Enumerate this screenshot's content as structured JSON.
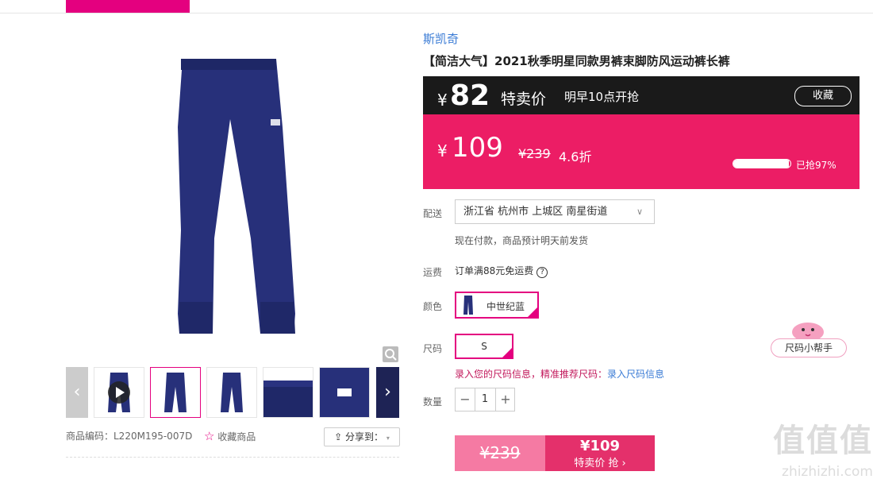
{
  "nav": {
    "active_color": "#e4007f"
  },
  "product": {
    "brand": "斯凯奇",
    "title": "【简洁大气】2021秋季明星同款男裤束脚防风运动裤长裤",
    "code_label": "商品编码：L220M195-007D",
    "favorite_label": "收藏商品",
    "share_label": "分享到：",
    "image_alt": "navy jogger pants"
  },
  "price": {
    "sale_yen": "¥",
    "sale_price": "82",
    "sale_tag": "特卖价",
    "notice": "明早10点开抢",
    "collect_label": "收藏",
    "current_yen": "¥",
    "current_price": "109",
    "original_price": "¥239",
    "discount": "4.6折",
    "sold_percent": 0.97,
    "sold_label": "已抢97%"
  },
  "options": {
    "delivery_label": "配送",
    "address": "浙江省 杭州市 上城区 南星街道",
    "delivery_hint": "现在付款，商品预计明天前发货",
    "shipping_label": "运费",
    "shipping_text": "订单满88元免运费",
    "shipping_help": "?",
    "color_label": "颜色",
    "color_value": "中世纪蓝",
    "size_label": "尺码",
    "size_value": "S",
    "size_hint": "录入您的尺码信息，精准推荐尺码：",
    "size_link": "录入尺码信息",
    "qty_label": "数量",
    "qty_value": "1",
    "qty_minus": "−",
    "qty_plus": "+",
    "helper_label": "尺码小帮手"
  },
  "buy": {
    "orig_price": "¥239",
    "price": "¥109",
    "button_label": "特卖价 抢 ›"
  },
  "watermark": {
    "brand": "值值值",
    "domain": "zhizhizhi.com"
  },
  "colors": {
    "pink": "#ec1d65",
    "magenta": "#e4007f",
    "dark": "#1a1a1a",
    "navy": "#1e2355"
  }
}
